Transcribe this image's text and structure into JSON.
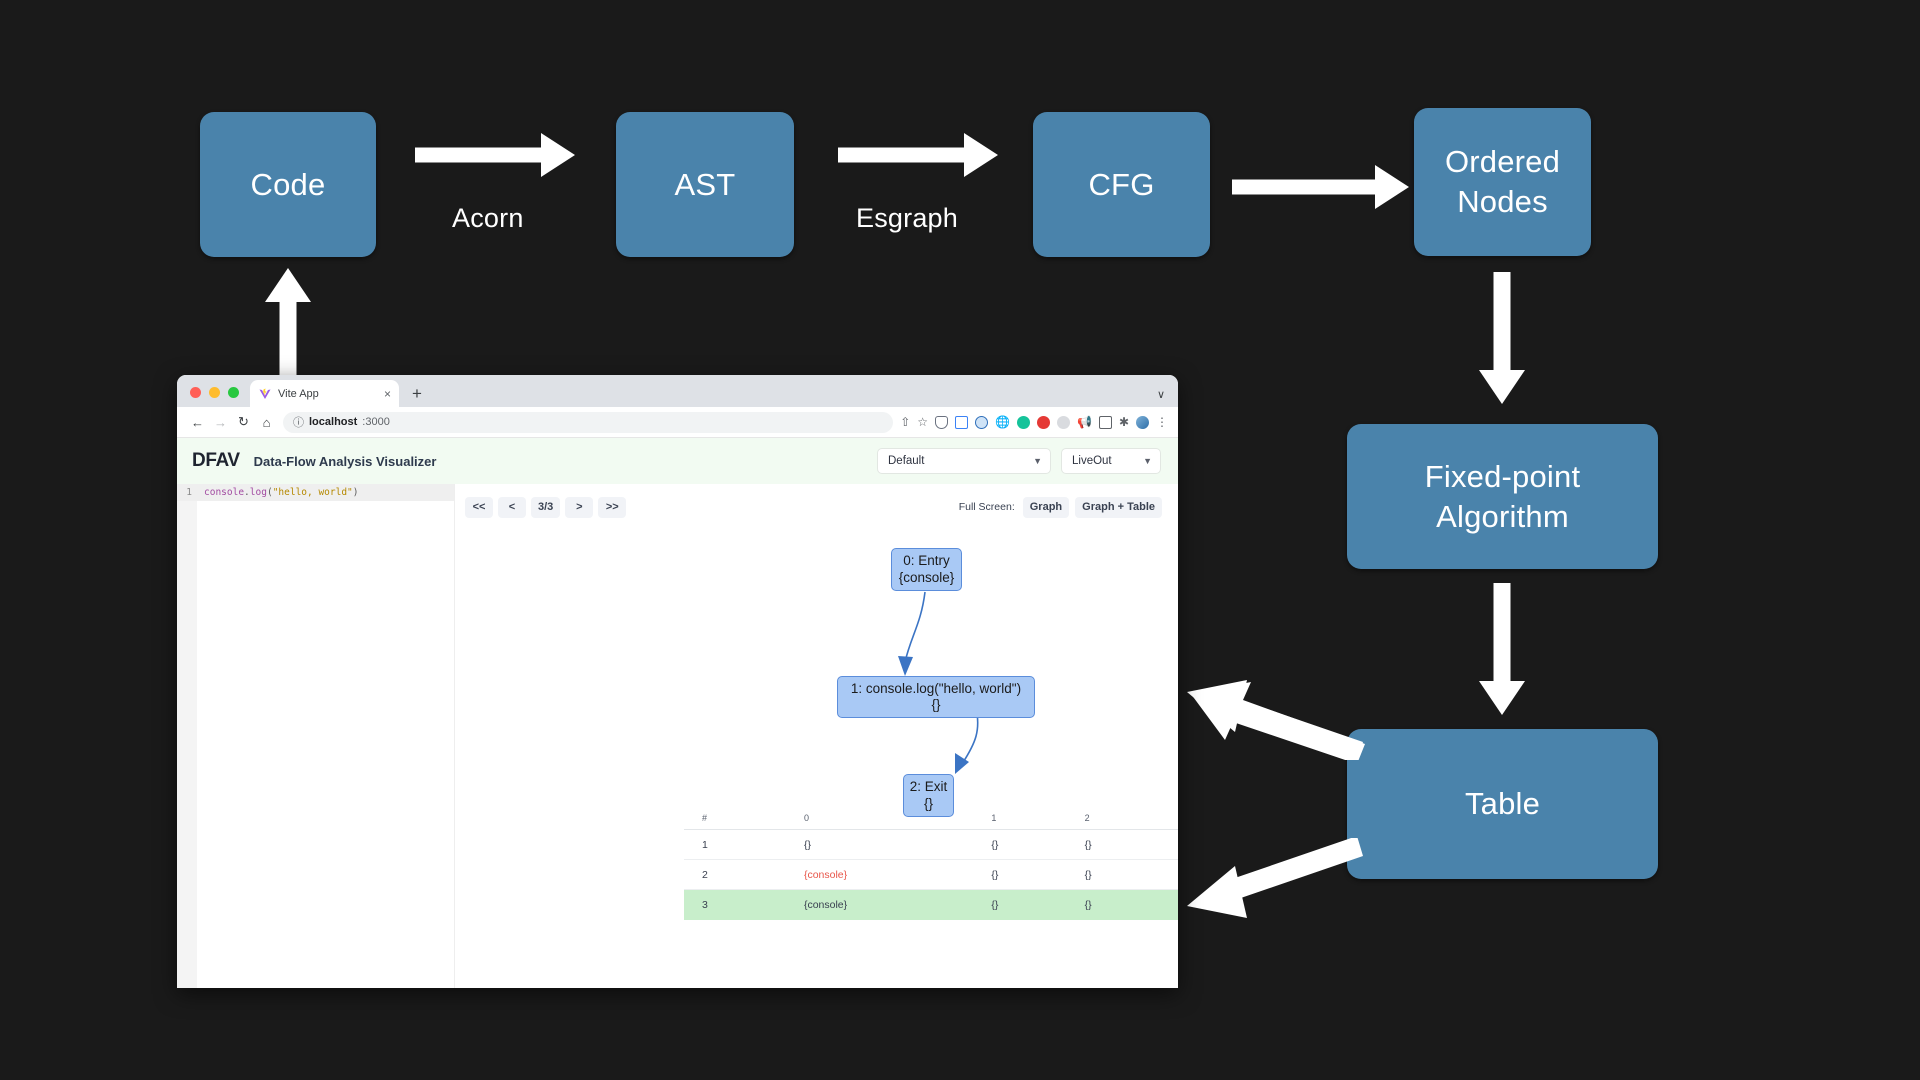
{
  "diagram": {
    "boxes": [
      {
        "name": "code",
        "label": "Code"
      },
      {
        "name": "ast",
        "label": "AST"
      },
      {
        "name": "cfg",
        "label": "CFG"
      },
      {
        "name": "ordered-nodes",
        "label": "Ordered\nNodes"
      },
      {
        "name": "fixed-point-algorithm",
        "label": "Fixed-point\nAlgorithm"
      },
      {
        "name": "table",
        "label": "Table"
      }
    ],
    "box_labels": {
      "code": "Code",
      "ast": "AST",
      "cfg": "CFG",
      "ordered_nodes_line1": "Ordered",
      "ordered_nodes_line2": "Nodes",
      "fixed_point_line1": "Fixed-point",
      "fixed_point_line2": "Algorithm",
      "table": "Table"
    },
    "edge_labels": {
      "code_to_ast": "Acorn",
      "ast_to_cfg": "Esgraph"
    },
    "accent_color": "#4a83ab",
    "background_color": "#1a1a1a",
    "arrow_color": "#ffffff"
  },
  "browser": {
    "tab": {
      "title": "Vite App",
      "close_label": "×",
      "favicon": "vite-logo-icon"
    },
    "new_tab_label": "+",
    "window_chevron": "∨",
    "nav": {
      "back": "←",
      "forward": "→",
      "reload": "↻",
      "home": "⌂"
    },
    "omnibox": {
      "info_icon": "ⓘ",
      "host": "localhost",
      "port": ":3000"
    },
    "menu_label": "⋮"
  },
  "app": {
    "brand": "DFAV",
    "title": "Data-Flow Analysis Visualizer",
    "selects": [
      {
        "name": "preset-select",
        "value": "Default"
      },
      {
        "name": "analysis-select",
        "value": "LiveOut"
      }
    ],
    "editor": {
      "line_number": "1",
      "code_tokens": [
        {
          "t": "console",
          "cls": "tk-obj"
        },
        {
          "t": ".",
          "cls": "tk-punc"
        },
        {
          "t": "log",
          "cls": "tk-obj"
        },
        {
          "t": "(",
          "cls": "tk-punc"
        },
        {
          "t": "\"hello, world\"",
          "cls": "tk-str"
        },
        {
          "t": ")",
          "cls": "tk-punc"
        }
      ],
      "code_plain": "console.log(\"hello, world\")"
    },
    "toolbar": {
      "first_label": "<<",
      "prev_label": "<",
      "counter_label": "3/3",
      "next_label": ">",
      "last_label": ">>",
      "fullscreen_label": "Full Screen:",
      "graph_button": "Graph",
      "graph_table_button": "Graph + Table"
    },
    "graph": {
      "nodes": [
        {
          "id": "0",
          "title": "0: Entry",
          "set": "{console}"
        },
        {
          "id": "1",
          "title": "1: console.log(\"hello, world\")",
          "set": "{}"
        },
        {
          "id": "2",
          "title": "2: Exit",
          "set": "{}"
        }
      ],
      "node_fill": "#a9c9f5",
      "node_stroke": "#5b8ddb"
    },
    "table": {
      "columns": [
        "#",
        "0",
        "1",
        "2"
      ],
      "rows": [
        {
          "cells": [
            "1",
            "{}",
            "{}",
            "{}"
          ],
          "highlight": false,
          "changed": false
        },
        {
          "cells": [
            "2",
            "{console}",
            "{}",
            "{}"
          ],
          "highlight": false,
          "changed": true
        },
        {
          "cells": [
            "3",
            "{console}",
            "{}",
            "{}"
          ],
          "highlight": true,
          "changed": false
        }
      ],
      "highlight_color": "#c8eecb",
      "changed_color": "#e8574b"
    }
  }
}
